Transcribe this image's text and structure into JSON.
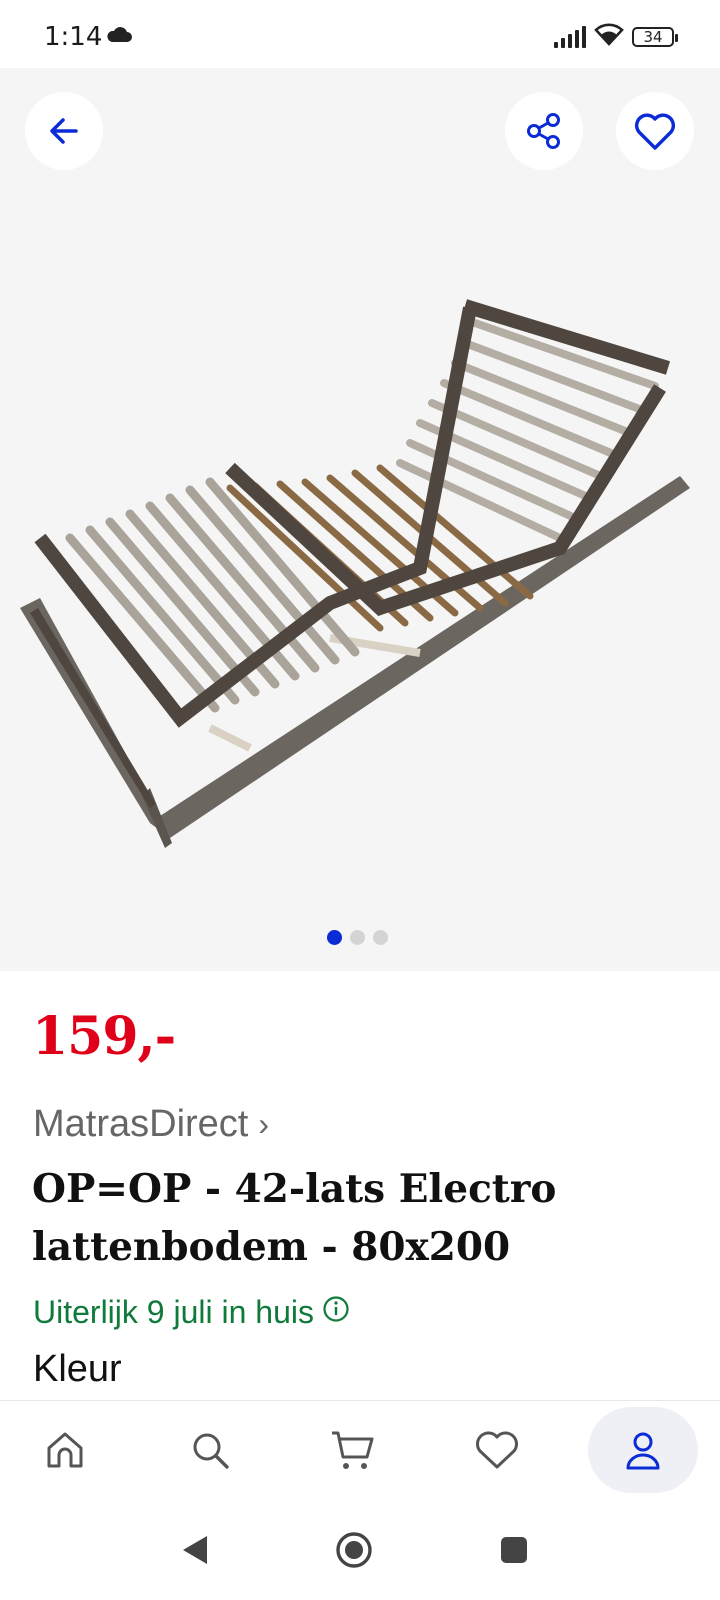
{
  "status_bar": {
    "time": "1:14",
    "battery": "34"
  },
  "gallery": {
    "image_count": 3,
    "active_index": 0
  },
  "product": {
    "price": "159,-",
    "seller": "MatrasDirect",
    "seller_chevron": "›",
    "title": "OP=OP - 42-lats Electro lattenbodem - 80x200",
    "delivery": "Uiterlijk 9 juli in huis",
    "color_label": "Kleur"
  },
  "colors": {
    "brand_blue": "#0a2bd6",
    "price_red": "#e0001a",
    "delivery_green": "#0f7a3a"
  },
  "icons": [
    "back-arrow-icon",
    "share-icon",
    "heart-icon",
    "home-icon",
    "search-icon",
    "cart-icon",
    "account-icon"
  ]
}
